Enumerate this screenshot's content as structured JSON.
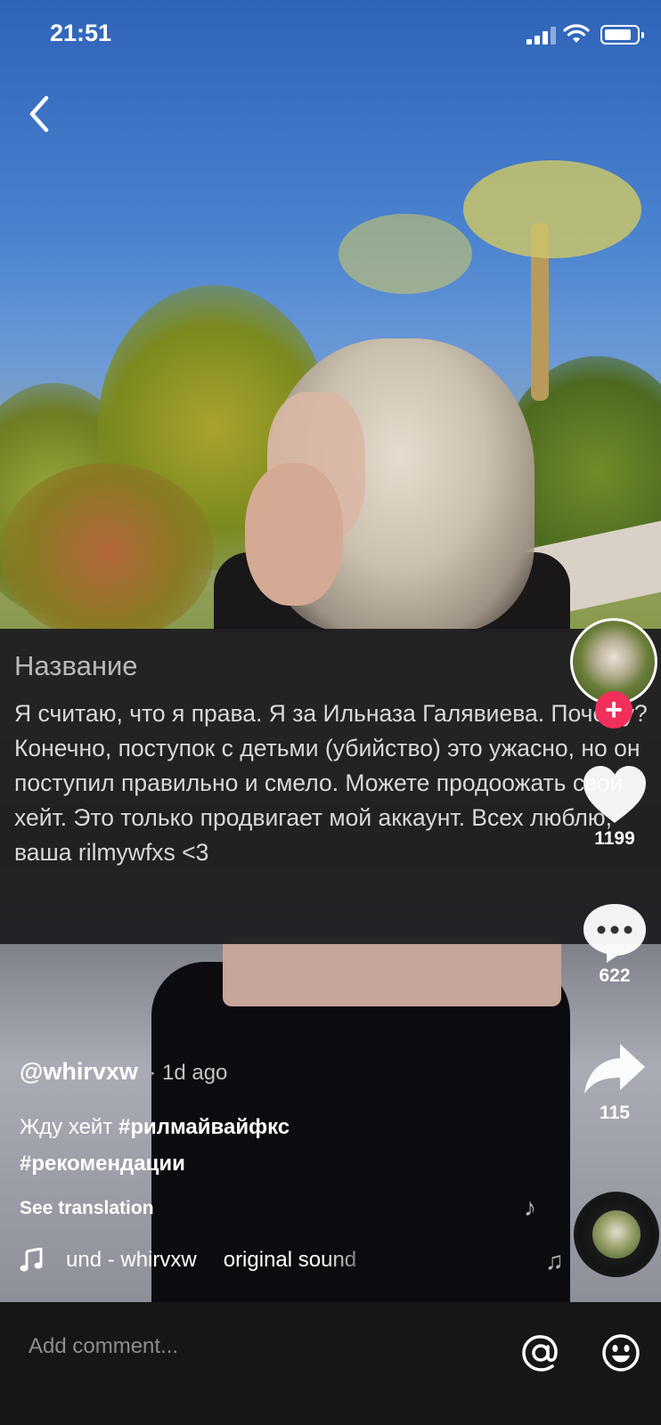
{
  "status_bar": {
    "time": "21:51",
    "battery_level": 0.85
  },
  "overlay": {
    "heading": "Название",
    "body": "Я считаю, что я права. Я за Ильназа Галявиева. Почему? Конечно, поступок с детьми (убийство) это ужасно, но он поступил правильно и смело. Можете продоожать свой хейт. Это только продвигает мой аккаунт. Всех люблю, ваша rilmywfxs <3"
  },
  "actions": {
    "likes": "1199",
    "comments": "622",
    "shares": "115"
  },
  "caption": {
    "username": "@whirvxw",
    "time_ago": "· 1d ago",
    "text_plain": "Жду хейт ",
    "hashtag_1": "#рилмайвайфкс",
    "hashtag_2": "#рекомендации",
    "see_translation": "See translation"
  },
  "sound": {
    "part_1": "und - whirvxw",
    "part_2": "original sound"
  },
  "comment_bar": {
    "placeholder": "Add comment..."
  },
  "icons": {
    "back": "chevron-left-icon",
    "like": "heart-icon",
    "comment": "speech-bubble-icon",
    "share": "share-arrow-icon",
    "music": "music-note-icon",
    "mention": "at-sign-icon",
    "emoji": "smiley-icon",
    "follow": "plus-icon"
  },
  "colors": {
    "follow_accent": "#f0305a",
    "overlay_bg": "#201e22",
    "comment_bar_bg": "#161617"
  }
}
